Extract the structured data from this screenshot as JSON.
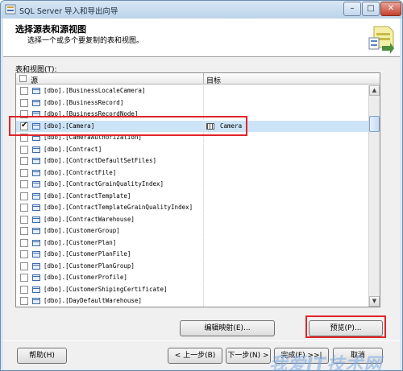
{
  "window": {
    "title": "SQL Server 导入和导出向导",
    "minimize": "–",
    "maximize": "□",
    "close": "✕"
  },
  "header": {
    "title": "选择源表和源视图",
    "subtitle": "选择一个或多个要复制的表和视图。"
  },
  "section_label": "表和视图(T):",
  "grid": {
    "columns": {
      "source": "源",
      "destination": "目标"
    },
    "rows": [
      {
        "source": "[dbo].[BusinessLocaleCamera]",
        "destination": "",
        "checked": false
      },
      {
        "source": "[dbo].[BusinessRecord]",
        "destination": "",
        "checked": false
      },
      {
        "source": "[dbo].[BusinessRecordNode]",
        "destination": "",
        "checked": false
      },
      {
        "source": "[dbo].[Camera]",
        "destination": "Camera",
        "checked": true,
        "selected": true
      },
      {
        "source": "[dbo].[CameraAuthorization]",
        "destination": "",
        "checked": false
      },
      {
        "source": "[dbo].[Contract]",
        "destination": "",
        "checked": false
      },
      {
        "source": "[dbo].[ContractDefaultSetFiles]",
        "destination": "",
        "checked": false
      },
      {
        "source": "[dbo].[ContractFile]",
        "destination": "",
        "checked": false
      },
      {
        "source": "[dbo].[ContractGrainQualityIndex]",
        "destination": "",
        "checked": false
      },
      {
        "source": "[dbo].[ContractTemplate]",
        "destination": "",
        "checked": false
      },
      {
        "source": "[dbo].[ContractTemplateGrainQualityIndex]",
        "destination": "",
        "checked": false
      },
      {
        "source": "[dbo].[ContractWarehouse]",
        "destination": "",
        "checked": false
      },
      {
        "source": "[dbo].[CustomerGroup]",
        "destination": "",
        "checked": false
      },
      {
        "source": "[dbo].[CustomerPlan]",
        "destination": "",
        "checked": false
      },
      {
        "source": "[dbo].[CustomerPlanFile]",
        "destination": "",
        "checked": false
      },
      {
        "source": "[dbo].[CustomerPlanGroup]",
        "destination": "",
        "checked": false
      },
      {
        "source": "[dbo].[CustomerProfile]",
        "destination": "",
        "checked": false
      },
      {
        "source": "[dbo].[CustomerShipingCertificate]",
        "destination": "",
        "checked": false
      },
      {
        "source": "[dbo].[DayDefaultWarehouse]",
        "destination": "",
        "checked": false
      }
    ]
  },
  "buttons": {
    "edit_mappings": "编辑映射(E)...",
    "preview": "预览(P)...",
    "help": "帮助(H)",
    "back": "< 上一步(B)",
    "next": "下一步(N) >",
    "finish": "完成(F) >>|",
    "cancel": "取消"
  },
  "watermark": "我爱IT技术网",
  "colors": {
    "highlight": "#e0242a",
    "selected_row": "#cde4f8"
  },
  "icons": {
    "header": "wizard-table-icon",
    "row": "table-icon",
    "destination": "destination-table-icon"
  }
}
